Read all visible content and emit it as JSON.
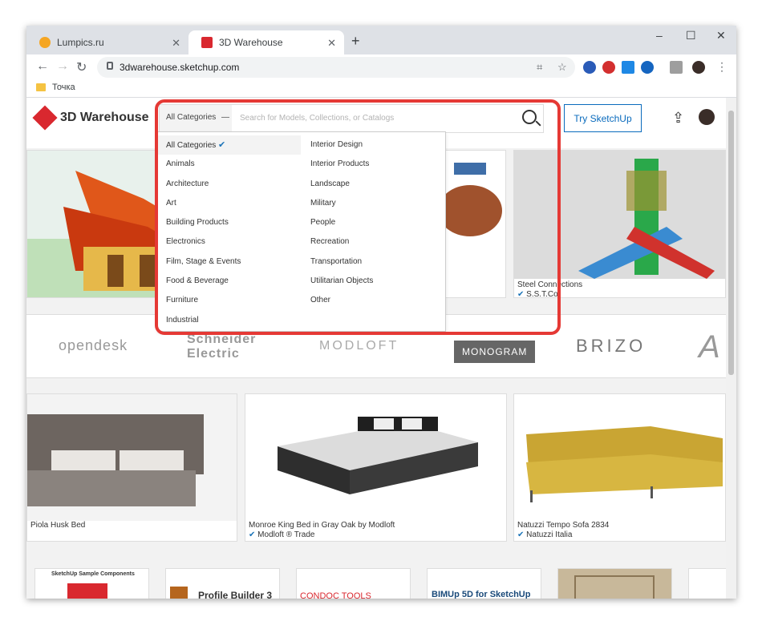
{
  "browser": {
    "tabs": [
      {
        "title": "Lumpics.ru",
        "favicon_color": "#f5a623",
        "active": false
      },
      {
        "title": "3D Warehouse",
        "favicon_color": "#d9282f",
        "active": true
      }
    ],
    "new_tab": "+",
    "window_controls": {
      "minimize": "–",
      "maximize": "☐",
      "close": "✕"
    },
    "nav": {
      "back": "←",
      "forward": "→",
      "reload": "↻"
    },
    "url": "3dwarehouse.sketchup.com",
    "bookmarks": [
      {
        "label": "Точка"
      }
    ]
  },
  "site": {
    "logo_text": "3D Warehouse",
    "category_select": "All Categories",
    "category_chevron": "—",
    "search_placeholder": "Search for Models, Collections, or Catalogs",
    "try_button": "Try SketchUp",
    "upload_icon": "⇪"
  },
  "dropdown": {
    "check": "✔",
    "selected": "All Categories",
    "col1": [
      "All Categories",
      "Animals",
      "Architecture",
      "Art",
      "Building Products",
      "Electronics",
      "Film, Stage & Events",
      "Food & Beverage",
      "Furniture",
      "Industrial"
    ],
    "col2": [
      "Interior Design",
      "Interior Products",
      "Landscape",
      "Military",
      "People",
      "Recreation",
      "Transportation",
      "Utilitarian Objects",
      "Other"
    ]
  },
  "top_cards": [
    {
      "title": "Steel Connections",
      "author": "S.S.T.Co"
    }
  ],
  "brands": [
    "opendesk",
    "Schneider Electric",
    "MODLOFT",
    "MONOGRAM",
    "BRIZO"
  ],
  "product_cards": [
    {
      "title": "Piola Husk Bed",
      "author": ""
    },
    {
      "title": "Monroe King Bed in Gray Oak by Modloft",
      "author": "Modloft ® Trade"
    },
    {
      "title": "Natuzzi Tempo Sofa 2834",
      "author": "Natuzzi Italia"
    }
  ],
  "bottom_thumbs": [
    "SketchUp Sample Components",
    "Profile Builder 3",
    "CONDOC TOOLS",
    "BIMUp 5D for SketchUp"
  ],
  "colors": {
    "accent": "#0a6bbd",
    "brand": "#d9282f",
    "highlight_ring": "#e53935"
  }
}
